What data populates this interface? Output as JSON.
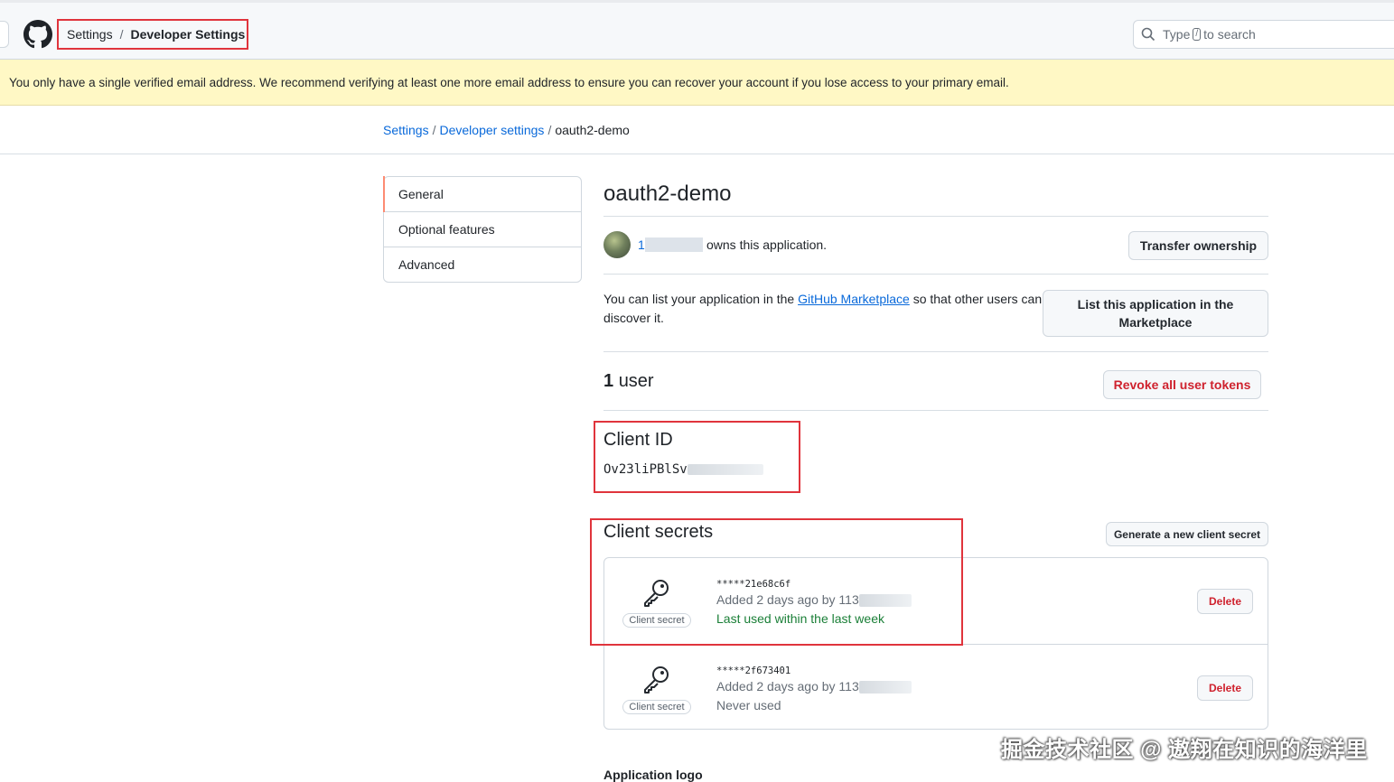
{
  "header": {
    "breadcrumb": [
      "Settings",
      "Developer Settings"
    ],
    "search_placeholder_before": "Type",
    "search_shortcut": "/",
    "search_placeholder_after": "to search"
  },
  "banner": {
    "text": "You only have a single verified email address. We recommend verifying at least one more email address to ensure you can recover your account if you lose access to your primary email."
  },
  "breadcrumb": {
    "items": [
      "Settings",
      "Developer settings"
    ],
    "current": "oauth2-demo"
  },
  "sidebar": {
    "items": [
      {
        "label": "General",
        "active": true
      },
      {
        "label": "Optional features"
      },
      {
        "label": "Advanced"
      }
    ]
  },
  "app": {
    "title": "oauth2-demo",
    "owner_prefix": "1",
    "owner_suffix": "owns this application.",
    "transfer_button": "Transfer ownership",
    "marketplace_text_before": "You can list your application in the",
    "marketplace_link": "GitHub Marketplace",
    "marketplace_text_after": "so that other users can discover it.",
    "list_button": "List this application in the Marketplace",
    "users_count": "1",
    "users_label": "user",
    "revoke_button": "Revoke all user tokens",
    "client_id_title": "Client ID",
    "client_id_value": "Ov23liPBlSv",
    "client_secrets_title": "Client secrets",
    "generate_button": "Generate a new client secret",
    "secrets": [
      {
        "masked": "*****21e68c6f",
        "added": "Added 2 days ago by 113",
        "usage": "Last used within the last week",
        "badge": "Client secret",
        "delete": "Delete"
      },
      {
        "masked": "*****2f673401",
        "added": "Added 2 days ago by 113",
        "usage": "Never used",
        "badge": "Client secret",
        "delete": "Delete"
      }
    ],
    "app_logo_title": "Application logo"
  },
  "watermark": "掘金技术社区 @ 遨翔在知识的海洋里",
  "colors": {
    "accent_red": "#e0343c",
    "link": "#0969da",
    "danger": "#cf222e",
    "success": "#1a7f37",
    "banner": "#fff8c5"
  }
}
